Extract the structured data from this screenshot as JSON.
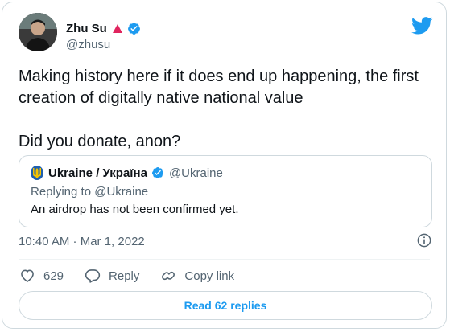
{
  "author": {
    "display_name": "Zhu Su",
    "handle": "@zhusu"
  },
  "tweet": {
    "line1": "Making history here if it does end up happening, the first",
    "line2": "creation of digitally native national value",
    "line3": "Did you donate, anon?"
  },
  "quoted": {
    "display_name": "Ukraine / Україна",
    "handle": "@Ukraine",
    "replying_to": "Replying to @Ukraine",
    "text": "An airdrop has not been confirmed yet."
  },
  "timestamp": "10:40 AM · Mar 1, 2022",
  "actions": {
    "like_count": "629",
    "reply_label": "Reply",
    "copy_label": "Copy link"
  },
  "read_replies_label": "Read 62 replies",
  "colors": {
    "accent": "#1d9bf0",
    "muted_text": "#536471",
    "warning_triangle": "#e0245e"
  },
  "icons": [
    "twitter-bird-icon",
    "verified-badge-icon",
    "warning-triangle-icon",
    "info-icon",
    "heart-icon",
    "reply-icon",
    "link-icon",
    "ukraine-trident-icon"
  ]
}
